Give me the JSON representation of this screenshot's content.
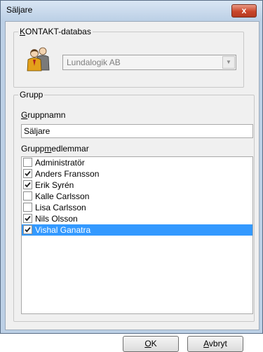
{
  "window": {
    "title": "Säljare",
    "close_glyph": "x"
  },
  "kontakt": {
    "group_title_prefix": "K",
    "group_title_rest": "ONTAKT-databas",
    "database_value": "Lundalogik AB",
    "icon": "people-icon"
  },
  "grupp": {
    "group_title": "Grupp",
    "name_label_prefix": "G",
    "name_label_rest": "ruppnamn",
    "name_value": "Säljare",
    "members_label_before": "Grupp",
    "members_label_underlined": "m",
    "members_label_after": "edlemmar",
    "members": [
      {
        "name": "Administratör",
        "checked": false,
        "selected": false
      },
      {
        "name": "Anders Fransson",
        "checked": true,
        "selected": false
      },
      {
        "name": "Erik Syrén",
        "checked": true,
        "selected": false
      },
      {
        "name": "Kalle Carlsson",
        "checked": false,
        "selected": false
      },
      {
        "name": "Lisa Carlsson",
        "checked": false,
        "selected": false
      },
      {
        "name": "Nils Olsson",
        "checked": true,
        "selected": false
      },
      {
        "name": "Vishal Ganatra",
        "checked": true,
        "selected": true
      }
    ]
  },
  "buttons": {
    "ok_prefix": "O",
    "ok_rest": "K",
    "cancel_prefix": "A",
    "cancel_rest": "vbryt"
  },
  "colors": {
    "selection": "#3399ff",
    "titlebar": "#bcd0e6",
    "close": "#c9462b"
  }
}
